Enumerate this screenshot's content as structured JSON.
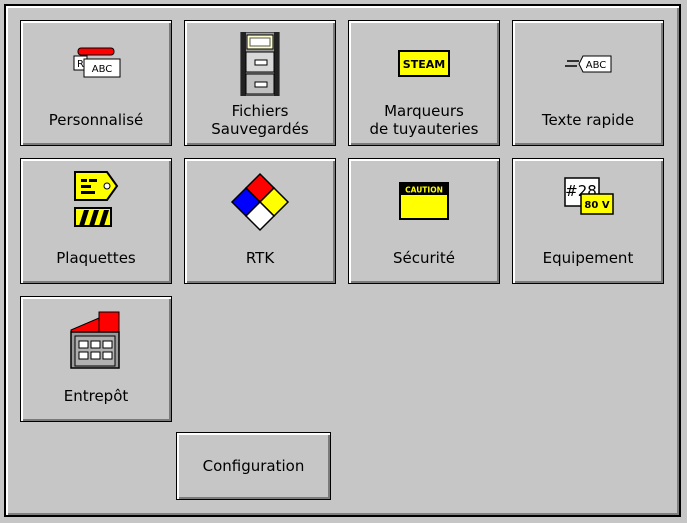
{
  "tiles": [
    {
      "label": "Personnalisé",
      "icon": "custom-label-icon",
      "abc": "ABC",
      "r": "R"
    },
    {
      "label": "Fichiers\nSauvegardés",
      "icon": "file-cabinet-icon"
    },
    {
      "label": "Marqueurs\nde tuyauteries",
      "icon": "pipe-marker-icon",
      "sign": "STEAM"
    },
    {
      "label": "Texte rapide",
      "icon": "quick-text-icon",
      "abc": "ABC"
    },
    {
      "label": "Plaquettes",
      "icon": "tag-icon"
    },
    {
      "label": "RTK",
      "icon": "hazard-diamond-icon"
    },
    {
      "label": "Sécurité",
      "icon": "caution-sign-icon",
      "sign": "CAUTION"
    },
    {
      "label": "Equipement",
      "icon": "equipment-label-icon",
      "num": "#28",
      "volt": "80 V"
    },
    {
      "label": "Entrepôt",
      "icon": "warehouse-icon"
    }
  ],
  "config_button": {
    "label": "Configuration"
  },
  "colors": {
    "bg": "#c6c6c6",
    "yellow": "#ffff00",
    "red": "#ff0000",
    "blue": "#0000ff"
  }
}
